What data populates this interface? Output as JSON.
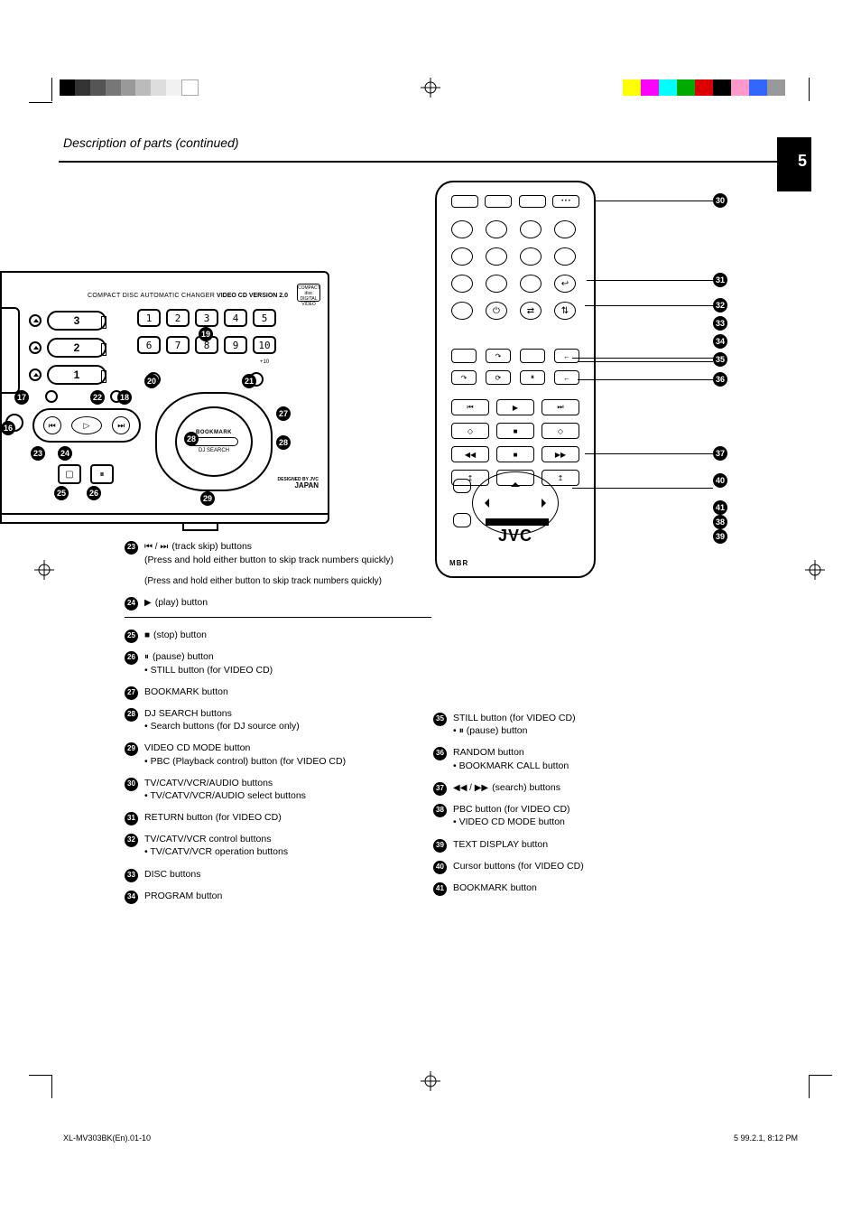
{
  "page": {
    "number": "5",
    "heading": "Description of parts (continued)"
  },
  "player": {
    "top_label": "COMPACT DISC AUTOMATIC CHANGER",
    "vcd": "VIDEO CD VERSION 2.0",
    "disc_logo_top": "COMPACT",
    "disc_logo_bot": "DIGITAL VIDEO",
    "tray1": "1",
    "tray2": "2",
    "tray3": "3",
    "numkeys": [
      "1",
      "2",
      "3",
      "4",
      "5",
      "6",
      "7",
      "8",
      "9",
      "10"
    ],
    "prog_plus10": "+10",
    "bookmark": "BOOKMARK",
    "djsearch": "DJ SEARCH",
    "japan_top": "DESIGNED BY JVC",
    "japan": "JAPAN"
  },
  "remote": {
    "brand": "JVC",
    "mbr": "MBR"
  },
  "list_left": [
    {
      "n": "23",
      "sym": "⏮ / ⏭",
      "t": "(track skip) buttons",
      "s": "(Press and hold either button to skip track numbers quickly)"
    },
    {
      "n": "24",
      "sym": "▶",
      "t": "(play) button",
      "sep": true
    },
    {
      "n": "25",
      "sym": "■",
      "t": "(stop) button"
    },
    {
      "n": "26",
      "sym": "⏸",
      "t": "(pause) button",
      "s": "• STILL button (for VIDEO CD)"
    },
    {
      "n": "27",
      "t": "BOOKMARK button"
    },
    {
      "n": "28",
      "t": "DJ SEARCH buttons",
      "s": "• Search buttons (for DJ source only)"
    },
    {
      "n": "29",
      "t": "VIDEO CD MODE button",
      "s": "• PBC (Playback control) button (for VIDEO CD)"
    },
    {
      "n": "30",
      "t": "TV/CATV/VCR/AUDIO buttons",
      "s": "• TV/CATV/VCR/AUDIO select buttons"
    },
    {
      "n": "31",
      "t": "RETURN button (for VIDEO CD)"
    },
    {
      "n": "32",
      "t": "TV/CATV/VCR control buttons",
      "s": "• TV/CATV/VCR operation buttons"
    },
    {
      "n": "33",
      "t": "DISC buttons"
    },
    {
      "n": "34",
      "t": "PROGRAM button"
    }
  ],
  "list_right": [
    {
      "n": "35",
      "t": "STILL button (for VIDEO CD)",
      "s": "• ⏸ (pause) button"
    },
    {
      "n": "36",
      "t": "RANDOM button",
      "s": "• BOOKMARK CALL button"
    },
    {
      "n": "37",
      "sym": "◀◀ / ▶▶",
      "t": "(search) buttons"
    },
    {
      "n": "38",
      "t": "PBC button (for VIDEO CD)",
      "s": "• VIDEO CD MODE button"
    },
    {
      "n": "39",
      "t": "TEXT DISPLAY button"
    },
    {
      "n": "40",
      "t": "Cursor buttons (for VIDEO CD)"
    },
    {
      "n": "41",
      "t": "BOOKMARK button"
    }
  ],
  "held_note": "(Press and hold either button to skip track numbers quickly)",
  "footer": {
    "file": "XL-MV303BK(En).01-10",
    "stamp": "5                                     99.2.1, 8:12 PM"
  }
}
